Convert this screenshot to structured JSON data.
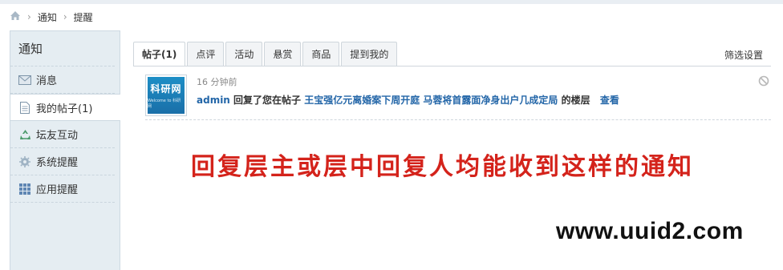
{
  "breadcrumb": {
    "home_icon": "home-icon",
    "items": [
      "通知",
      "提醒"
    ]
  },
  "sidebar": {
    "title": "通知",
    "items": [
      {
        "icon": "envelope-icon",
        "label": "消息"
      },
      {
        "icon": "document-icon",
        "label": "我的帖子(1)"
      },
      {
        "icon": "recycle-icon",
        "label": "坛友互动"
      },
      {
        "icon": "gear-icon",
        "label": "系统提醒"
      },
      {
        "icon": "grid-icon",
        "label": "应用提醒"
      }
    ]
  },
  "tabs": [
    "帖子(1)",
    "点评",
    "活动",
    "悬赏",
    "商品",
    "提到我的"
  ],
  "filter_link": "筛选设置",
  "notice": {
    "avatar_text": "科研网",
    "avatar_sub": "Welcome to 科研网",
    "time": "16 分钟前",
    "user": "admin",
    "action": "回复了您在帖子",
    "post_title": "王宝强亿元离婚案下周开庭 马蓉将首露面净身出户几成定局",
    "suffix": "的楼层",
    "view": "查看"
  },
  "annotation": "回复层主或层中回复人均能收到这样的通知",
  "watermark": "www.uuid2.com",
  "colors": {
    "link": "#2366a8",
    "annotation": "#d4231b",
    "sidebar_bg": "#e5edf2"
  }
}
